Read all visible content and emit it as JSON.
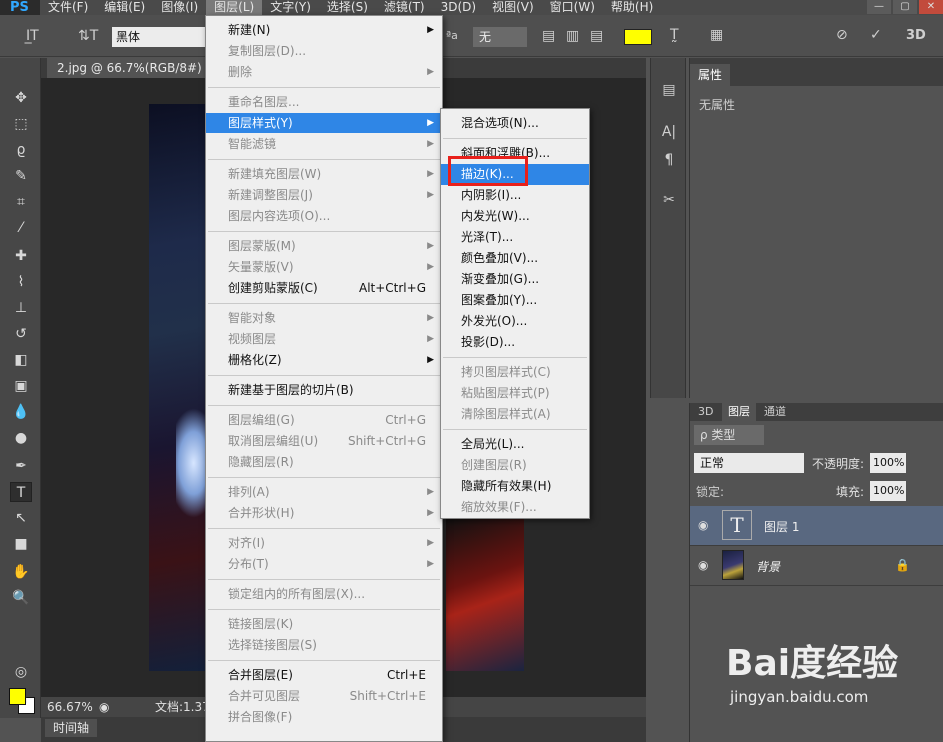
{
  "app": {
    "logo": "PS"
  },
  "menubar": {
    "items": [
      "文件(F)",
      "编辑(E)",
      "图像(I)",
      "图层(L)",
      "文字(Y)",
      "选择(S)",
      "滤镜(T)",
      "3D(D)",
      "视图(V)",
      "窗口(W)",
      "帮助(H)"
    ],
    "active_index": 3,
    "window_controls": [
      "—",
      "▢",
      "✕"
    ]
  },
  "options": {
    "font": "黑体",
    "antialias": "无",
    "text_color": "#ffff00",
    "icons": [
      "type-tool-icon",
      "orientation-icon",
      "aa-label",
      "align-left-icon",
      "align-center-icon",
      "align-right-icon",
      "warp-text-icon",
      "panels-icon",
      "cancel-icon",
      "commit-icon",
      "3d-label"
    ],
    "aa_label": "ªa",
    "label_3d": "3D"
  },
  "document": {
    "tab_title": "2.jpg @ 66.7%(RGB/8#)",
    "tab_close": "×",
    "zoom": "66.67%",
    "doc_info": "文档:1.37"
  },
  "timeline": {
    "label": "时间轴"
  },
  "layer_menu": {
    "items": [
      {
        "label": "新建(N)",
        "disabled": false,
        "arrow": true
      },
      {
        "label": "复制图层(D)...",
        "disabled": true
      },
      {
        "label": "删除",
        "disabled": true,
        "arrow": true
      },
      {
        "sep": true
      },
      {
        "label": "重命名图层...",
        "disabled": true
      },
      {
        "label": "图层样式(Y)",
        "disabled": false,
        "arrow": true,
        "highlight": true
      },
      {
        "label": "智能滤镜",
        "disabled": true,
        "arrow": true
      },
      {
        "sep": true
      },
      {
        "label": "新建填充图层(W)",
        "disabled": true,
        "arrow": true
      },
      {
        "label": "新建调整图层(J)",
        "disabled": true,
        "arrow": true
      },
      {
        "label": "图层内容选项(O)...",
        "disabled": true
      },
      {
        "sep": true
      },
      {
        "label": "图层蒙版(M)",
        "disabled": true,
        "arrow": true
      },
      {
        "label": "矢量蒙版(V)",
        "disabled": true,
        "arrow": true
      },
      {
        "label": "创建剪贴蒙版(C)",
        "disabled": false,
        "shortcut": "Alt+Ctrl+G"
      },
      {
        "sep": true
      },
      {
        "label": "智能对象",
        "disabled": true,
        "arrow": true
      },
      {
        "label": "视频图层",
        "disabled": true,
        "arrow": true
      },
      {
        "label": "栅格化(Z)",
        "disabled": false,
        "arrow": true
      },
      {
        "sep": true
      },
      {
        "label": "新建基于图层的切片(B)",
        "disabled": false
      },
      {
        "sep": true
      },
      {
        "label": "图层编组(G)",
        "disabled": true,
        "shortcut": "Ctrl+G"
      },
      {
        "label": "取消图层编组(U)",
        "disabled": true,
        "shortcut": "Shift+Ctrl+G"
      },
      {
        "label": "隐藏图层(R)",
        "disabled": true
      },
      {
        "sep": true
      },
      {
        "label": "排列(A)",
        "disabled": true,
        "arrow": true
      },
      {
        "label": "合并形状(H)",
        "disabled": true,
        "arrow": true
      },
      {
        "sep": true
      },
      {
        "label": "对齐(I)",
        "disabled": true,
        "arrow": true
      },
      {
        "label": "分布(T)",
        "disabled": true,
        "arrow": true
      },
      {
        "sep": true
      },
      {
        "label": "锁定组内的所有图层(X)...",
        "disabled": true
      },
      {
        "sep": true
      },
      {
        "label": "链接图层(K)",
        "disabled": true
      },
      {
        "label": "选择链接图层(S)",
        "disabled": true
      },
      {
        "sep": true
      },
      {
        "label": "合并图层(E)",
        "disabled": false,
        "shortcut": "Ctrl+E"
      },
      {
        "label": "合并可见图层",
        "disabled": true,
        "shortcut": "Shift+Ctrl+E"
      },
      {
        "label": "拼合图像(F)",
        "disabled": true
      }
    ]
  },
  "style_submenu": {
    "items": [
      {
        "label": "混合选项(N)...",
        "disabled": false
      },
      {
        "sep": true
      },
      {
        "label": "斜面和浮雕(B)...",
        "disabled": false
      },
      {
        "label": "描边(K)...",
        "disabled": false,
        "highlight": true
      },
      {
        "label": "内阴影(I)...",
        "disabled": false
      },
      {
        "label": "内发光(W)...",
        "disabled": false
      },
      {
        "label": "光泽(T)...",
        "disabled": false
      },
      {
        "label": "颜色叠加(V)...",
        "disabled": false
      },
      {
        "label": "渐变叠加(G)...",
        "disabled": false
      },
      {
        "label": "图案叠加(Y)...",
        "disabled": false
      },
      {
        "label": "外发光(O)...",
        "disabled": false
      },
      {
        "label": "投影(D)...",
        "disabled": false
      },
      {
        "sep": true
      },
      {
        "label": "拷贝图层样式(C)",
        "disabled": true
      },
      {
        "label": "粘贴图层样式(P)",
        "disabled": true
      },
      {
        "label": "清除图层样式(A)",
        "disabled": true
      },
      {
        "sep": true
      },
      {
        "label": "全局光(L)...",
        "disabled": false
      },
      {
        "label": "创建图层(R)",
        "disabled": true
      },
      {
        "label": "隐藏所有效果(H)",
        "disabled": false
      },
      {
        "label": "缩放效果(F)...",
        "disabled": true
      }
    ]
  },
  "properties": {
    "tab": "属性",
    "empty_text": "无属性"
  },
  "layers": {
    "tabs": [
      "3D",
      "图层",
      "通道"
    ],
    "active_tab": 1,
    "filter": "ρ 类型",
    "blend_mode": "正常",
    "opacity_label": "不透明度:",
    "opacity": "100%",
    "lock_label": "锁定:",
    "fill_label": "填充:",
    "fill": "100%",
    "rows": [
      {
        "name": "图层 1",
        "type": "text",
        "thumb": "T",
        "selected": true
      },
      {
        "name": "背景",
        "type": "image",
        "locked": true,
        "selected": false
      }
    ]
  },
  "watermark": {
    "main": "Bai度经验",
    "sub": "jingyan.baidu.com"
  }
}
